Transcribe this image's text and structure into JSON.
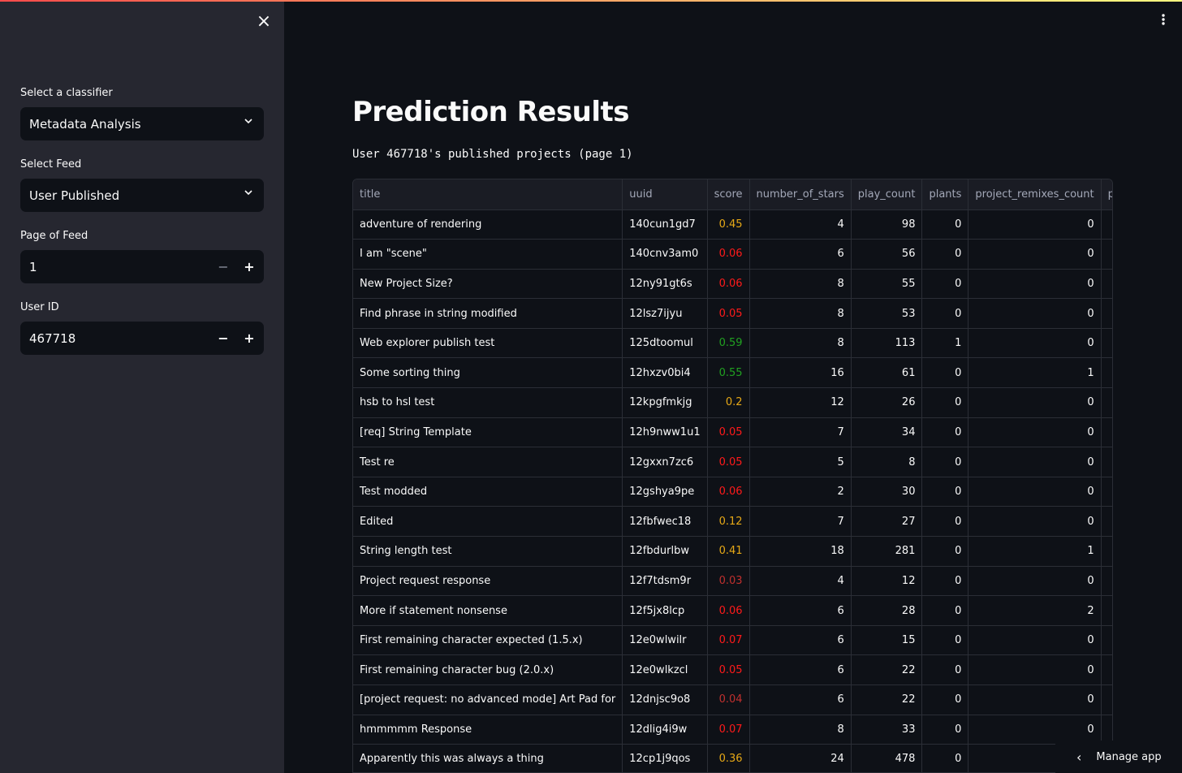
{
  "sidebar": {
    "close_icon": "close-icon",
    "classifier": {
      "label": "Select a classifier",
      "value": "Metadata Analysis"
    },
    "feed": {
      "label": "Select Feed",
      "value": "User Published"
    },
    "page": {
      "label": "Page of Feed",
      "value": "1",
      "minus": "−",
      "plus": "+"
    },
    "user": {
      "label": "User ID",
      "value": "467718",
      "minus": "−",
      "plus": "+"
    }
  },
  "main": {
    "title": "Prediction Results",
    "caption": "User 467718's published projects (page 1)",
    "manage_app": "Manage app"
  },
  "colors": {
    "score_high": "#21a121",
    "score_mid": "#e6a817",
    "score_low": "#ff1a1a",
    "score_verylow": "#c0302e",
    "accent_gradient": [
      "#ff4b4b",
      "#fffd80"
    ]
  },
  "table": {
    "columns": [
      "title",
      "uuid",
      "score",
      "number_of_stars",
      "play_count",
      "plants",
      "project_remixes_count",
      "published_re"
    ],
    "rows": [
      [
        "adventure of rendering",
        "140cun1gd7",
        "0.45",
        "4",
        "98",
        "0",
        "0"
      ],
      [
        "I am \"scene\"",
        "140cnv3am0",
        "0.06",
        "6",
        "56",
        "0",
        "0"
      ],
      [
        "New Project Size?",
        "12ny91gt6s",
        "0.06",
        "8",
        "55",
        "0",
        "0"
      ],
      [
        "Find phrase in string modified",
        "12lsz7ijyu",
        "0.05",
        "8",
        "53",
        "0",
        "0"
      ],
      [
        "Web explorer publish test",
        "125dtoomul",
        "0.59",
        "8",
        "113",
        "1",
        "0"
      ],
      [
        "Some sorting thing",
        "12hxzv0bi4",
        "0.55",
        "16",
        "61",
        "0",
        "1"
      ],
      [
        "hsb to hsl test",
        "12kpgfmkjg",
        "0.2",
        "12",
        "26",
        "0",
        "0"
      ],
      [
        "[req] String Template",
        "12h9nww1u1",
        "0.05",
        "7",
        "34",
        "0",
        "0"
      ],
      [
        "Test re",
        "12gxxn7zc6",
        "0.05",
        "5",
        "8",
        "0",
        "0"
      ],
      [
        "Test modded",
        "12gshya9pe",
        "0.06",
        "2",
        "30",
        "0",
        "0"
      ],
      [
        "Edited",
        "12fbfwec18",
        "0.12",
        "7",
        "27",
        "0",
        "0"
      ],
      [
        "String length test",
        "12fbdurlbw",
        "0.41",
        "18",
        "281",
        "0",
        "1"
      ],
      [
        "Project request response",
        "12f7tdsm9r",
        "0.03",
        "4",
        "12",
        "0",
        "0"
      ],
      [
        "More if statement nonsense",
        "12f5jx8lcp",
        "0.06",
        "6",
        "28",
        "0",
        "2"
      ],
      [
        "First remaining character expected (1.5.x)",
        "12e0wlwilr",
        "0.07",
        "6",
        "15",
        "0",
        "0"
      ],
      [
        "First remaining character bug (2.0.x)",
        "12e0wlkzcl",
        "0.05",
        "6",
        "22",
        "0",
        "0"
      ],
      [
        "[project request: no advanced mode] Art Pad for",
        "12dnjsc9o8",
        "0.04",
        "6",
        "22",
        "0",
        "0"
      ],
      [
        "hmmmmm Response",
        "12dlig4i9w",
        "0.07",
        "8",
        "33",
        "0",
        "0"
      ],
      [
        "Apparently this was always a thing",
        "12cp1j9qos",
        "0.36",
        "24",
        "478",
        "0",
        "2"
      ]
    ]
  }
}
